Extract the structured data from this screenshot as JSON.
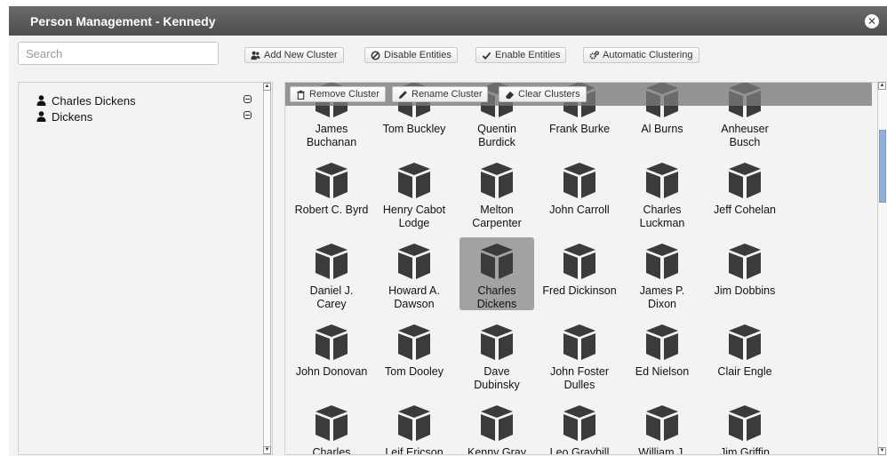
{
  "window": {
    "title": "Person Management - Kennedy"
  },
  "search": {
    "placeholder": "Search",
    "value": ""
  },
  "toolbar": {
    "add_cluster": "Add New Cluster",
    "disable_entities": "Disable Entities",
    "enable_entities": "Enable Entities",
    "auto_cluster": "Automatic Clustering"
  },
  "tree": {
    "items": [
      {
        "label": "Charles Dickens"
      },
      {
        "label": "Dickens"
      }
    ]
  },
  "cluster_toolbar": {
    "remove": "Remove Cluster",
    "rename": "Rename Cluster",
    "clear": "Clear Clusters"
  },
  "entities": [
    {
      "line1": "James",
      "line2": "Buchanan"
    },
    {
      "line1": "Tom Buckley",
      "line2": ""
    },
    {
      "line1": "Quentin",
      "line2": "Burdick"
    },
    {
      "line1": "Frank Burke",
      "line2": ""
    },
    {
      "line1": "Al Burns",
      "line2": ""
    },
    {
      "line1": "Anheuser",
      "line2": "Busch"
    },
    {
      "line1": "Robert C. Byrd",
      "line2": ""
    },
    {
      "line1": "Henry Cabot",
      "line2": "Lodge"
    },
    {
      "line1": "Melton",
      "line2": "Carpenter"
    },
    {
      "line1": "John Carroll",
      "line2": ""
    },
    {
      "line1": "Charles",
      "line2": "Luckman"
    },
    {
      "line1": "Jeff Cohelan",
      "line2": ""
    },
    {
      "line1": "Daniel J.",
      "line2": "Carey"
    },
    {
      "line1": "Howard A.",
      "line2": "Dawson"
    },
    {
      "line1": "Charles",
      "line2": "Dickens",
      "selected": true
    },
    {
      "line1": "Fred Dickinson",
      "line2": ""
    },
    {
      "line1": "James P.",
      "line2": "Dixon"
    },
    {
      "line1": "Jim Dobbins",
      "line2": ""
    },
    {
      "line1": "John Donovan",
      "line2": ""
    },
    {
      "line1": "Tom Dooley",
      "line2": ""
    },
    {
      "line1": "Dave",
      "line2": "Dubinsky"
    },
    {
      "line1": "John Foster",
      "line2": "Dulles"
    },
    {
      "line1": "Ed Nielson",
      "line2": ""
    },
    {
      "line1": "Clair Engle",
      "line2": ""
    },
    {
      "line1": "Charles",
      "line2": ""
    },
    {
      "line1": "Leif Ericson",
      "line2": ""
    },
    {
      "line1": "Kenny Gray",
      "line2": ""
    },
    {
      "line1": "Leo Graybill",
      "line2": ""
    },
    {
      "line1": "William J.",
      "line2": ""
    },
    {
      "line1": "Jim Griffin",
      "line2": ""
    }
  ],
  "icons": {
    "close": "close-icon",
    "add": "users-add-icon",
    "disable": "ban-icon",
    "enable": "check-icon",
    "auto": "gears-icon",
    "remove": "trash-icon",
    "rename": "pencil-icon",
    "clear": "eraser-icon",
    "entity": "cube-icon",
    "person": "user-icon"
  },
  "colors": {
    "titlebar": "#555555",
    "selection": "#a2a2a2",
    "cube": "#3b3b3b",
    "scroll_thumb": "#8fb0d8"
  }
}
